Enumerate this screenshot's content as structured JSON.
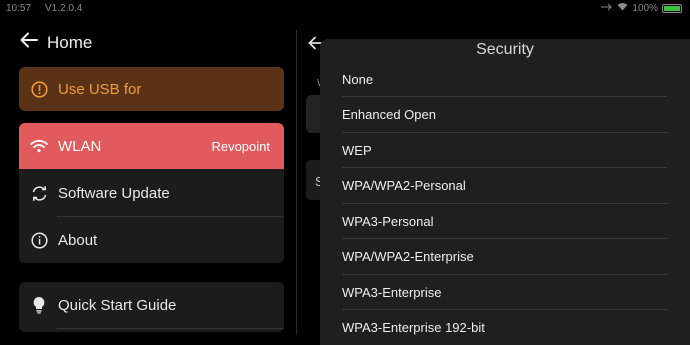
{
  "status_bar": {
    "time": "10:57",
    "version": "V1.2.0.4",
    "battery": "100%"
  },
  "header": {
    "back_label": "Home"
  },
  "usb_card": {
    "label": "Use USB for"
  },
  "menu": {
    "wlan": {
      "label": "WLAN",
      "value": "Revopoint"
    },
    "software_update": {
      "label": "Software Update"
    },
    "about": {
      "label": "About"
    }
  },
  "guide": {
    "label": "Quick Start Guide"
  },
  "background_right": {
    "small_text": "W",
    "row_letter": "S"
  },
  "dialog": {
    "title": "Security",
    "options": [
      "None",
      "Enhanced Open",
      "WEP",
      "WPA/WPA2-Personal",
      "WPA3-Personal",
      "WPA/WPA2-Enterprise",
      "WPA3-Enterprise",
      "WPA3-Enterprise 192-bit"
    ]
  },
  "colors": {
    "accent_red": "#e15a5d",
    "usb_bg": "#5a3316",
    "usb_text": "#f09a3a",
    "card_bg": "#1c1c1c",
    "dialog_bg": "#1f1f1f"
  }
}
